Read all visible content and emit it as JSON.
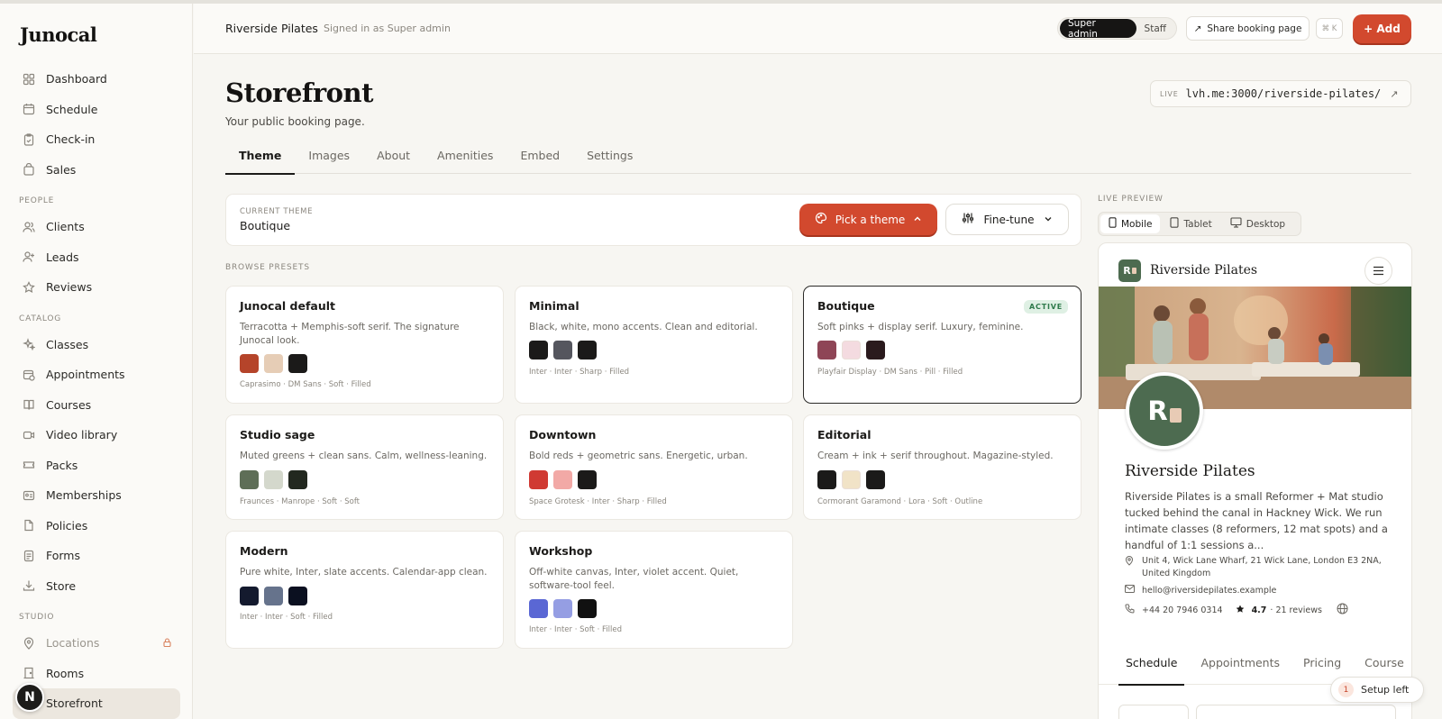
{
  "app": {
    "logo": "Junocal"
  },
  "sidebar": {
    "items": [
      {
        "label": "Dashboard",
        "icon": "dashboard-icon"
      },
      {
        "label": "Schedule",
        "icon": "calendar-icon"
      },
      {
        "label": "Check-in",
        "icon": "clipboard-check-icon"
      },
      {
        "label": "Sales",
        "icon": "shopping-bag-icon"
      }
    ],
    "people_label": "PEOPLE",
    "people": [
      {
        "label": "Clients",
        "icon": "users-icon"
      },
      {
        "label": "Leads",
        "icon": "user-plus-icon"
      },
      {
        "label": "Reviews",
        "icon": "star-icon"
      }
    ],
    "catalog_label": "CATALOG",
    "catalog": [
      {
        "label": "Classes",
        "icon": "sparkles-icon"
      },
      {
        "label": "Appointments",
        "icon": "calendar-clock-icon"
      },
      {
        "label": "Courses",
        "icon": "book-icon"
      },
      {
        "label": "Video library",
        "icon": "video-icon"
      },
      {
        "label": "Packs",
        "icon": "ticket-icon"
      },
      {
        "label": "Memberships",
        "icon": "id-card-icon"
      },
      {
        "label": "Policies",
        "icon": "file-icon"
      },
      {
        "label": "Forms",
        "icon": "form-icon"
      },
      {
        "label": "Store",
        "icon": "download-icon"
      }
    ],
    "studio_label": "STUDIO",
    "studio": [
      {
        "label": "Locations",
        "icon": "map-pin-icon"
      },
      {
        "label": "Rooms",
        "icon": "door-icon"
      },
      {
        "label": "Storefront",
        "icon": "palette-icon"
      }
    ],
    "avatar_letter": "N"
  },
  "header": {
    "studio_name": "Riverside Pilates",
    "signed_in": "Signed in as Super admin",
    "roles": [
      "Super admin",
      "Staff"
    ],
    "share_label": "Share booking page",
    "shortcut": "⌘ K",
    "add_label": "+ Add"
  },
  "page": {
    "title": "Storefront",
    "subtitle": "Your public booking page.",
    "live_label": "LIVE",
    "live_url": "lvh.me:3000/riverside-pilates/",
    "tabs": [
      "Theme",
      "Images",
      "About",
      "Amenities",
      "Embed",
      "Settings"
    ],
    "active_tab": "Theme"
  },
  "theme": {
    "current_caption": "CURRENT THEME",
    "current_value": "Boutique",
    "pick_label": "Pick a theme",
    "finetune_label": "Fine-tune",
    "browse_label": "BROWSE PRESETS",
    "active_badge": "ACTIVE",
    "presets": [
      {
        "name": "Junocal default",
        "desc": "Terracotta + Memphis-soft serif. The signature Junocal look.",
        "colors": [
          "#b5442a",
          "#e6cdb6",
          "#1b1a19"
        ],
        "meta": "Caprasimo · DM Sans · Soft · Filled"
      },
      {
        "name": "Minimal",
        "desc": "Black, white, mono accents. Clean and editorial.",
        "colors": [
          "#1b1a19",
          "#55565e",
          "#1b1a19"
        ],
        "meta": "Inter · Inter · Sharp · Filled"
      },
      {
        "name": "Boutique",
        "desc": "Soft pinks + display serif. Luxury, feminine.",
        "colors": [
          "#8e4556",
          "#f4dbe0",
          "#2a1a1d"
        ],
        "meta": "Playfair Display · DM Sans · Pill · Filled",
        "active": true
      },
      {
        "name": "Studio sage",
        "desc": "Muted greens + clean sans. Calm, wellness-leaning.",
        "colors": [
          "#5e6e57",
          "#d4d8cc",
          "#22281f"
        ],
        "meta": "Fraunces · Manrope · Soft · Soft"
      },
      {
        "name": "Downtown",
        "desc": "Bold reds + geometric sans. Energetic, urban.",
        "colors": [
          "#d03a33",
          "#f2a9a6",
          "#1b1a19"
        ],
        "meta": "Space Grotesk · Inter · Sharp · Filled"
      },
      {
        "name": "Editorial",
        "desc": "Cream + ink + serif throughout. Magazine-styled.",
        "colors": [
          "#1b1a19",
          "#f1e3c7",
          "#1b1a19"
        ],
        "meta": "Cormorant Garamond · Lora · Soft · Outline"
      },
      {
        "name": "Modern",
        "desc": "Pure white, Inter, slate accents. Calendar-app clean.",
        "colors": [
          "#141a2e",
          "#66738c",
          "#0b1020"
        ],
        "meta": "Inter · Inter · Soft · Filled"
      },
      {
        "name": "Workshop",
        "desc": "Off-white canvas, Inter, violet accent. Quiet, software-tool feel.",
        "colors": [
          "#5a67d4",
          "#959ee3",
          "#111111"
        ],
        "meta": "Inter · Inter · Soft · Filled"
      }
    ]
  },
  "preview": {
    "label": "LIVE PREVIEW",
    "devices": [
      "Mobile",
      "Tablet",
      "Desktop"
    ],
    "logo_text": "R",
    "brand_name": "Riverside Pilates",
    "avatar_text": "R",
    "title": "Riverside Pilates",
    "description": "Riverside Pilates is a small Reformer + Mat studio tucked behind the canal in Hackney Wick. We run intimate classes (8 reformers, 12 mat spots) and a handful of 1:1 sessions a...",
    "address": "Unit 4, Wick Lane Wharf, 21 Wick Lane, London E3 2NA, United Kingdom",
    "email": "hello@riversidepilates.example",
    "phone": "+44 20 7946 0314",
    "rating": "4.7",
    "reviews": "· 21 reviews",
    "tabs": [
      "Schedule",
      "Appointments",
      "Pricing",
      "Course"
    ]
  },
  "setup": {
    "count": "1",
    "label": "Setup left"
  },
  "colors": {
    "accent": "#d2492e",
    "sage": "#4d6b50"
  }
}
